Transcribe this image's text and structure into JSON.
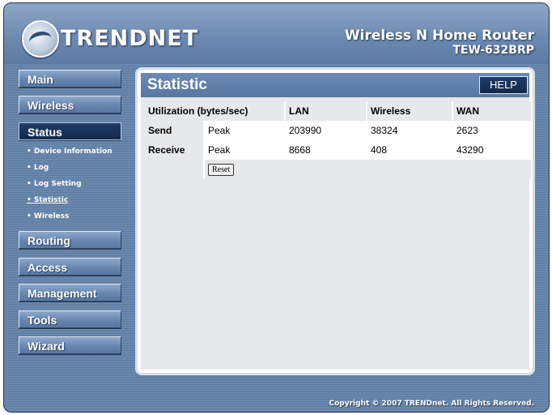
{
  "header": {
    "logo_text": "TRENDNET",
    "product_name": "Wireless N Home Router",
    "model": "TEW-632BRP"
  },
  "nav": {
    "items": [
      "Main",
      "Wireless",
      "Status",
      "Routing",
      "Access",
      "Management",
      "Tools",
      "Wizard"
    ],
    "active": "Status",
    "status_sub": [
      "Device Information",
      "Log",
      "Log Setting",
      "Statistic",
      "Wireless"
    ],
    "active_sub": "Statistic"
  },
  "page": {
    "title": "Statistic",
    "help_label": "HELP"
  },
  "table": {
    "headers": [
      "Utilization (bytes/sec)",
      "",
      "LAN",
      "Wireless",
      "WAN"
    ],
    "rows": [
      {
        "label": "Send",
        "type": "Peak",
        "lan": "203990",
        "wireless": "38324",
        "wan": "2623"
      },
      {
        "label": "Receive",
        "type": "Peak",
        "lan": "8668",
        "wireless": "408",
        "wan": "43290"
      }
    ],
    "reset_label": "Reset"
  },
  "footer": {
    "copyright": "Copyright © 2007 TRENDnet. All Rights Reserved."
  }
}
